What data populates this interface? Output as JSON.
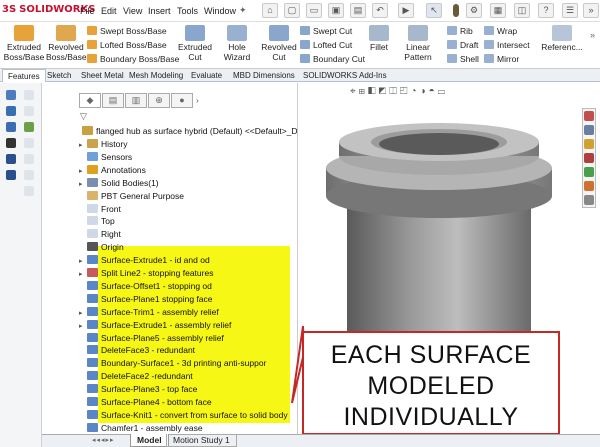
{
  "app": {
    "brand": "SOLIDWORKS",
    "ds_mark": "3S"
  },
  "menu": [
    "File",
    "Edit",
    "View",
    "Insert",
    "Tools",
    "Window"
  ],
  "toolbar": {
    "extruded_boss": "Extruded\nBoss/Base",
    "revolved_boss": "Revolved\nBoss/Base",
    "swept_boss": "Swept Boss/Base",
    "lofted_boss": "Lofted Boss/Base",
    "boundary_boss": "Boundary Boss/Base",
    "extruded_cut": "Extruded\nCut",
    "hole_wizard": "Hole Wizard",
    "revolved_cut": "Revolved\nCut",
    "swept_cut": "Swept Cut",
    "lofted_cut": "Lofted Cut",
    "boundary_cut": "Boundary Cut",
    "fillet": "Fillet",
    "linear_pattern": "Linear Pattern",
    "rib": "Rib",
    "draft": "Draft",
    "shell": "Shell",
    "wrap": "Wrap",
    "intersect": "Intersect",
    "mirror": "Mirror",
    "reference": "Referenc..."
  },
  "tabs": [
    "Features",
    "Sketch",
    "Sheet Metal",
    "Mesh Modeling",
    "Evaluate",
    "MBD Dimensions",
    "SOLIDWORKS Add-Ins"
  ],
  "tree": {
    "root": "flanged hub as surface hybrid (Default) <<Default>_D",
    "items": [
      {
        "label": "History",
        "arrow": "▸",
        "color": "#c9a24a"
      },
      {
        "label": "Sensors",
        "arrow": "",
        "color": "#6fa0d8"
      },
      {
        "label": "Annotations",
        "arrow": "▸",
        "color": "#e0a020"
      },
      {
        "label": "Solid Bodies(1)",
        "arrow": "▸",
        "color": "#7a8fb0"
      },
      {
        "label": "PBT General Purpose",
        "arrow": "",
        "color": "#d9b36a"
      },
      {
        "label": "Front",
        "arrow": "",
        "color": "#cfd8e6"
      },
      {
        "label": "Top",
        "arrow": "",
        "color": "#cfd8e6"
      },
      {
        "label": "Right",
        "arrow": "",
        "color": "#cfd8e6"
      },
      {
        "label": "Origin",
        "arrow": "",
        "color": "#555555"
      },
      {
        "label": "Surface-Extrude1 - id and od",
        "arrow": "▸",
        "color": "#5b86c5"
      },
      {
        "label": "Split Line2 - stopping features",
        "arrow": "▸",
        "color": "#c95a5a"
      },
      {
        "label": "Surface-Offset1 - stopping od",
        "arrow": "",
        "color": "#5b86c5"
      },
      {
        "label": "Surface-Plane1 stopping face",
        "arrow": "",
        "color": "#5b86c5"
      },
      {
        "label": "Surface-Trim1 - assembly relief",
        "arrow": "▸",
        "color": "#5b86c5"
      },
      {
        "label": "Surface-Extrude1 - assembly relief",
        "arrow": "▸",
        "color": "#5b86c5"
      },
      {
        "label": "Surface-Plane5 - assembly relief",
        "arrow": "",
        "color": "#5b86c5"
      },
      {
        "label": "DeleteFace3 - redundant",
        "arrow": "",
        "color": "#5b86c5"
      },
      {
        "label": "Boundary-Surface1 - 3d printing anti-suppor",
        "arrow": "",
        "color": "#5b86c5"
      },
      {
        "label": "DeleteFace2 -redundant",
        "arrow": "",
        "color": "#5b86c5"
      },
      {
        "label": "Surface-Plane3 - top face",
        "arrow": "",
        "color": "#5b86c5"
      },
      {
        "label": "Surface-Plane4 - bottom face",
        "arrow": "",
        "color": "#5b86c5"
      },
      {
        "label": "Surface-Knit1 - convert from surface to solid body",
        "arrow": "",
        "color": "#5b86c5"
      },
      {
        "label": "Chamfer1 - assembly ease",
        "arrow": "",
        "color": "#5b86c5"
      }
    ]
  },
  "callout": {
    "line1": "EACH SURFACE",
    "line2": "MODELED",
    "line3": "INDIVIDUALLY"
  },
  "bottom_tabs": [
    "Model",
    "Motion Study 1"
  ],
  "colors": {
    "highlight": "#f7f715",
    "callout_border": "#c62828",
    "brand": "#c8102e"
  }
}
